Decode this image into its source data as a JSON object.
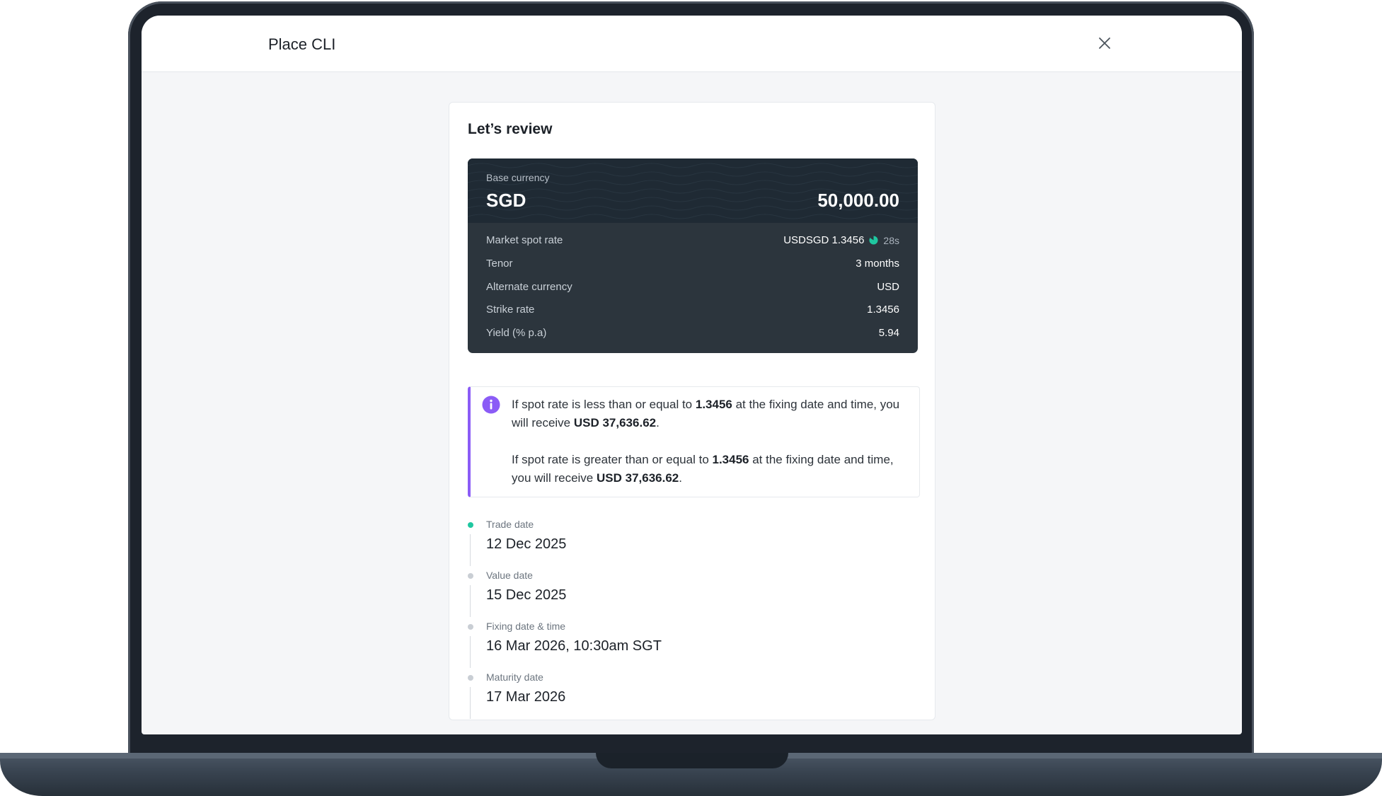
{
  "modal": {
    "title": "Place CLI"
  },
  "review": {
    "title": "Let’s review",
    "base": {
      "label": "Base currency",
      "currency": "SGD",
      "amount": "50,000.00"
    },
    "details": {
      "spot": {
        "label": "Market spot rate",
        "value": "USDSGD 1.3456",
        "countdown": "28s"
      },
      "tenor": {
        "label": "Tenor",
        "value": "3 months"
      },
      "alternate": {
        "label": "Alternate currency",
        "value": "USD"
      },
      "strike": {
        "label": "Strike rate",
        "value": "1.3456"
      },
      "yield": {
        "label": "Yield (% p.a)",
        "value": "5.94"
      }
    },
    "info": {
      "p1_a": "If spot rate is less than or equal to ",
      "p1_rate": "1.3456",
      "p1_b": " at the fixing date and time, you will receive ",
      "p1_amt": "USD 37,636.62",
      "p1_c": ".",
      "p2_a": "If spot rate is greater than or equal to ",
      "p2_rate": "1.3456",
      "p2_b": " at the fixing date and time, you will receive ",
      "p2_amt": "USD 37,636.62",
      "p2_c": "."
    },
    "timeline": {
      "trade": {
        "label": "Trade date",
        "value": "12 Dec 2025"
      },
      "value_date": {
        "label": "Value date",
        "value": "15 Dec 2025"
      },
      "fixing": {
        "label": "Fixing date & time",
        "value": "16 Mar 2026, 10:30am SGT"
      },
      "maturity": {
        "label": "Maturity date",
        "value": "17 Mar 2026"
      }
    }
  },
  "colors": {
    "accent": "#8b5cf6",
    "active_dot": "#1fc7a0",
    "dark_panel": "#2c353d"
  }
}
